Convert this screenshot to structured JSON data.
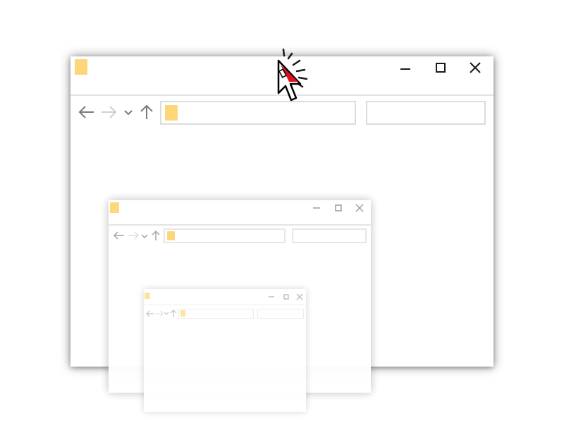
{
  "windows": [
    {
      "id": "outer",
      "icon": "folder-icon",
      "controls": [
        "minimize-icon",
        "maximize-icon",
        "close-icon"
      ],
      "toolbar": [
        "back-arrow-icon",
        "forward-arrow-icon",
        "recent-dropdown-icon",
        "up-arrow-icon"
      ],
      "address_value": "",
      "search_value": ""
    },
    {
      "id": "middle",
      "icon": "folder-icon",
      "controls": [
        "minimize-icon",
        "maximize-icon",
        "close-icon"
      ],
      "toolbar": [
        "back-arrow-icon",
        "forward-arrow-icon",
        "recent-dropdown-icon",
        "up-arrow-icon"
      ],
      "address_value": "",
      "search_value": ""
    },
    {
      "id": "inner",
      "icon": "folder-icon",
      "controls": [
        "minimize-icon",
        "maximize-icon",
        "close-icon"
      ],
      "toolbar": [
        "back-arrow-icon",
        "forward-arrow-icon",
        "recent-dropdown-icon",
        "up-arrow-icon"
      ],
      "address_value": "",
      "search_value": ""
    }
  ],
  "cursor": {
    "icon": "mouse-pointer-click-icon"
  },
  "colors": {
    "folder": "#fcd679",
    "cursor_accent": "#e3101a",
    "icon_dark": "#1a1a1a",
    "icon_grey": "#8a8a8a",
    "icon_light": "#cfcfcf",
    "border": "#dcdcdc"
  }
}
